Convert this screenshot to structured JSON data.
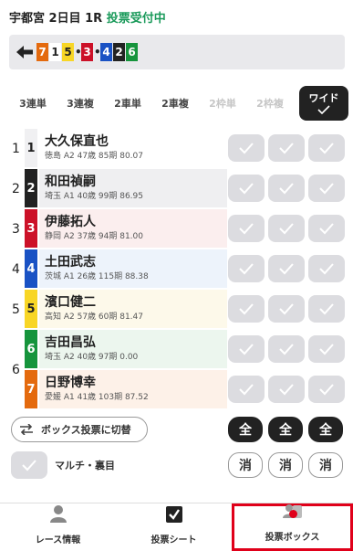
{
  "header": {
    "race": "宇都宮 2日目 1R",
    "status": "投票受付中",
    "status_color": "#1a9a5a"
  },
  "selection": {
    "chips": [
      {
        "num": "7",
        "bg": "#e46a0e",
        "fg": "#ffffff"
      },
      {
        "num": "1",
        "bg": "#ffffff",
        "fg": "#222222"
      },
      {
        "num": "5",
        "bg": "#f8d626",
        "fg": "#222222"
      },
      {
        "sep": "•"
      },
      {
        "num": "3",
        "bg": "#cc1128",
        "fg": "#ffffff"
      },
      {
        "sep": "•"
      },
      {
        "num": "4",
        "bg": "#1a52c4",
        "fg": "#ffffff"
      },
      {
        "num": "2",
        "bg": "#222222",
        "fg": "#ffffff"
      },
      {
        "num": "6",
        "bg": "#16943c",
        "fg": "#ffffff"
      }
    ]
  },
  "tabs": [
    {
      "label": "3連単",
      "disabled": false
    },
    {
      "label": "3連複",
      "disabled": false
    },
    {
      "label": "2車単",
      "disabled": false
    },
    {
      "label": "2車複",
      "disabled": false
    },
    {
      "label": "2枠単",
      "disabled": true
    },
    {
      "label": "2枠複",
      "disabled": true
    },
    {
      "label": "ワイド",
      "active": true
    }
  ],
  "riders": [
    {
      "frame": "1",
      "num": "1",
      "name": "大久保直也",
      "meta": "徳島 A2 47歳 85期 80.07",
      "num_bg": "#f0f0f2",
      "num_fg": "#222222",
      "row_bg": "#ffffff"
    },
    {
      "frame": "2",
      "num": "2",
      "name": "和田禎嗣",
      "meta": "埼玉 A1 40歳 99期 86.95",
      "num_bg": "#222222",
      "num_fg": "#ffffff",
      "row_bg": "#efeff1"
    },
    {
      "frame": "3",
      "num": "3",
      "name": "伊藤拓人",
      "meta": "静岡 A2 37歳 94期 81.00",
      "num_bg": "#cc1128",
      "num_fg": "#ffffff",
      "row_bg": "#fbeeee"
    },
    {
      "frame": "4",
      "num": "4",
      "name": "土田武志",
      "meta": "茨城 A1 26歳 115期 88.38",
      "num_bg": "#1a52c4",
      "num_fg": "#ffffff",
      "row_bg": "#edf3fb"
    },
    {
      "frame": "5",
      "num": "5",
      "name": "濱口健二",
      "meta": "高知 A2 57歳 60期 81.47",
      "num_bg": "#f8d626",
      "num_fg": "#222222",
      "row_bg": "#fdf9ea"
    },
    {
      "frame": "6",
      "num": "6",
      "name": "吉田昌弘",
      "meta": "埼玉 A2 40歳 97期 0.00",
      "num_bg": "#16943c",
      "num_fg": "#ffffff",
      "row_bg": "#ecf6ee"
    },
    {
      "frame": "",
      "num": "7",
      "name": "日野博幸",
      "meta": "愛媛 A1 41歳 103期 87.52",
      "num_bg": "#e46a0e",
      "num_fg": "#ffffff",
      "row_bg": "#fdf1e8"
    }
  ],
  "controls": {
    "box_toggle": "ボックス投票に切替",
    "all_label": "全",
    "clear_label": "消",
    "multi_label": "マルチ・裏目"
  },
  "nav": [
    {
      "label": "レース情報",
      "icon": "person-icon"
    },
    {
      "label": "投票シート",
      "icon": "checkbox-icon"
    },
    {
      "label": "投票ボックス",
      "icon": "ticket-box-icon",
      "active": true
    }
  ]
}
